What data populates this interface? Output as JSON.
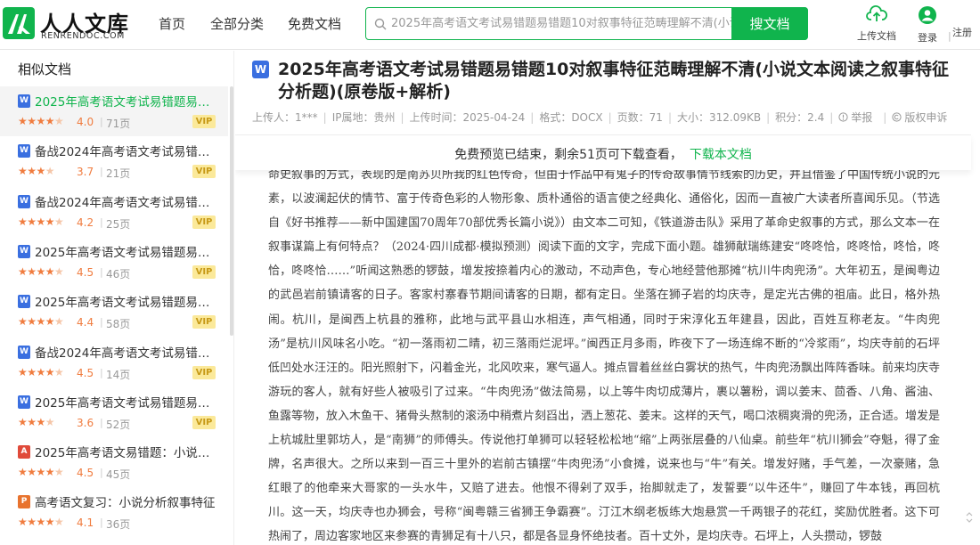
{
  "header": {
    "logo_name": "人人文库",
    "logo_sub": "RENRENDOC.COM",
    "nav": [
      "首页",
      "全部分类",
      "免费文档"
    ],
    "search": {
      "placeholder": "2025年高考语文考试易错题易错题10对叙事特征范畴理解不清(小说",
      "button": "搜文档"
    },
    "upload_label": "上传文档",
    "login_label": "登录",
    "register_label": "注册",
    "separator": "|"
  },
  "sidebar": {
    "title": "相似文档",
    "items": [
      {
        "icon": "word-doc-icon",
        "icon_letter": "W",
        "icon_color": "#3a6fe0",
        "title": "2025年高考语文考试易错题易错...",
        "stars": "★★★★",
        "half": "★",
        "rating": "4.0",
        "pages": "71页",
        "vip": "VIP",
        "active": true
      },
      {
        "icon": "word-doc-icon",
        "icon_letter": "W",
        "icon_color": "#3a6fe0",
        "title": "备战2024年高考语文考试易错题1...",
        "stars": "★★★",
        "half": "★",
        "rating": "3.7",
        "pages": "21页",
        "vip": "VIP"
      },
      {
        "icon": "word-doc-icon",
        "icon_letter": "W",
        "icon_color": "#3a6fe0",
        "title": "备战2024年高考语文考试易错题1...",
        "stars": "★★★★",
        "half": "★",
        "rating": "4.2",
        "pages": "25页",
        "vip": "VIP"
      },
      {
        "icon": "word-doc-icon",
        "icon_letter": "W",
        "icon_color": "#3a6fe0",
        "title": "2025年高考语文考试易错题易错...",
        "stars": "★★★★",
        "half": "★",
        "rating": "4.5",
        "pages": "46页",
        "vip": "VIP"
      },
      {
        "icon": "word-doc-icon",
        "icon_letter": "W",
        "icon_color": "#3a6fe0",
        "title": "2025年高考语文考试易错题易错...",
        "stars": "★★★★",
        "half": "★",
        "rating": "4.4",
        "pages": "58页",
        "vip": "VIP"
      },
      {
        "icon": "word-doc-icon",
        "icon_letter": "W",
        "icon_color": "#3a6fe0",
        "title": "备战2024年高考语文考试易错题1...",
        "stars": "★★★★",
        "half": "★",
        "rating": "4.5",
        "pages": "14页",
        "vip": "VIP"
      },
      {
        "icon": "word-doc-icon",
        "icon_letter": "W",
        "icon_color": "#3a6fe0",
        "title": "2025年高考语文考试易错题易错...",
        "stars": "★★★",
        "half": "★",
        "rating": "3.6",
        "pages": "52页",
        "vip": "VIP"
      },
      {
        "icon": "pdf-doc-icon",
        "icon_letter": "A",
        "icon_color": "#e04a3a",
        "title": "2025年高考语文易错题：小说文...",
        "stars": "★★★★",
        "half": "★",
        "rating": "4.5",
        "pages": "45页",
        "vip": ""
      },
      {
        "icon": "ppt-doc-icon",
        "icon_letter": "P",
        "icon_color": "#e8732e",
        "title": "高考语文复习：小说分析叙事特征",
        "stars": "★★★★",
        "half": "★",
        "rating": "4.1",
        "pages": "36页",
        "vip": ""
      }
    ]
  },
  "main": {
    "icon_letter": "W",
    "title": "2025年高考语文考试易错题易错题10对叙事特征范畴理解不清(小说文本阅读之叙事特征分析题)(原卷版+解析)",
    "meta": {
      "uploader": "上传人：1***",
      "ip": "IP属地：贵州",
      "upload_time": "上传时间：2025-04-24",
      "format": "格式：DOCX",
      "pages": "页数：71",
      "size": "大小：312.09KB",
      "points": "积分：2.4",
      "report": "举报",
      "copyright": "版权申诉"
    },
    "preview": {
      "text": "免费预览已结束，剩余51页可下载查看，",
      "link": "下载本文档"
    },
    "body_text": "命史叙事的方式，表现的是南苏贝所我的红色传奇，但由于作品中有鬼子的传奇故事情节线索的历史，并且借鉴了中国传统小说的元素，以波澜起伏的情节、富于传奇色彩的人物形象、质朴通俗的语言使之经典化、通俗化，因而一直被广大读者所喜闻乐见。（节选自《好书推荐——新中国建国70周年70部优秀长篇小说》）由文本二可知，《铁道游击队》采用了革命史叙事的方式，那么文本一在叙事谋篇上有何特点？（2024·四川成都·模拟预测）阅读下面的文字，完成下面小题。雄狮献瑞练建安“咚咚恰，咚咚恰，咚恰，咚恰，咚咚恰……”听闻这熟悉的锣鼓，增发按捺着内心的激动，不动声色，专心地经营他那摊“杭川牛肉兜汤”。大年初五，是闽粤边的武邑岩前镇请客的日子。客家村寨春节期间请客的日期，都有定日。坐落在狮子岩的均庆寺，是定光古佛的祖庙。此日，格外热闹。杭川，是闽西上杭县的雅称，此地与武平县山水相连，声气相通，同时于宋淳化五年建县，因此，百姓互称老友。“牛肉兜汤”是杭川风味名小吃。“初一落雨初二晴，初三落雨烂泥坪。”闽西正月多雨，昨夜下了一场连绵不断的“冷浆雨”，均庆寺前的石坪低凹处水汪汪的。阳光照射下，闪着金光，北风吹来，寒气逼人。摊点冒着丝丝白雾状的热气，牛肉兜汤飘出阵阵香味。前来均庆寺游玩的客人，就有好些人被吸引了过来。“牛肉兜汤”做法简易，以上等牛肉切成薄片，裹以薯粉，调以姜末、茴香、八角、酱油、鱼露等物，放入木鱼干、猪骨头熬制的滚汤中稍煮片刻舀出，洒上葱花、姜末。这样的天气，喝口浓稠爽滑的兜汤，正合适。增发是上杭城肚里郭坊人，是“南狮”的师傅头。传说他打单狮可以轻轻松松地“缩”上两张层叠的八仙桌。前些年“杭川狮会”夺魁，得了金牌，名声很大。之所以来到一百三十里外的岩前古镇摆“牛肉兜汤”小食摊，说来也与“牛”有关。增发好赌，手气差，一次豪赌，急红眼了的他牵来大哥家的一头水牛，又赔了进去。他恨不得剁了双手，抬脚就走了，发誓要“以牛还牛”，赚回了牛本钱，再回杭川。这一天，均庆寺也办狮会，号称“闽粤赣三省狮王争霸赛”。汀江木纲老板练大炮悬赏一千两银子的花红，奖励优胜者。这下可热闹了，周边客家地区来参赛的青狮足有十八只，都是各显身怀绝技者。百十丈外，是均庆寺。石坪上，人头攒动，锣鼓"
  },
  "colors": {
    "brand": "#10b44d",
    "star": "#f07c3f",
    "vip_bg": "#fbe99a",
    "vip_text": "#c79a17"
  }
}
